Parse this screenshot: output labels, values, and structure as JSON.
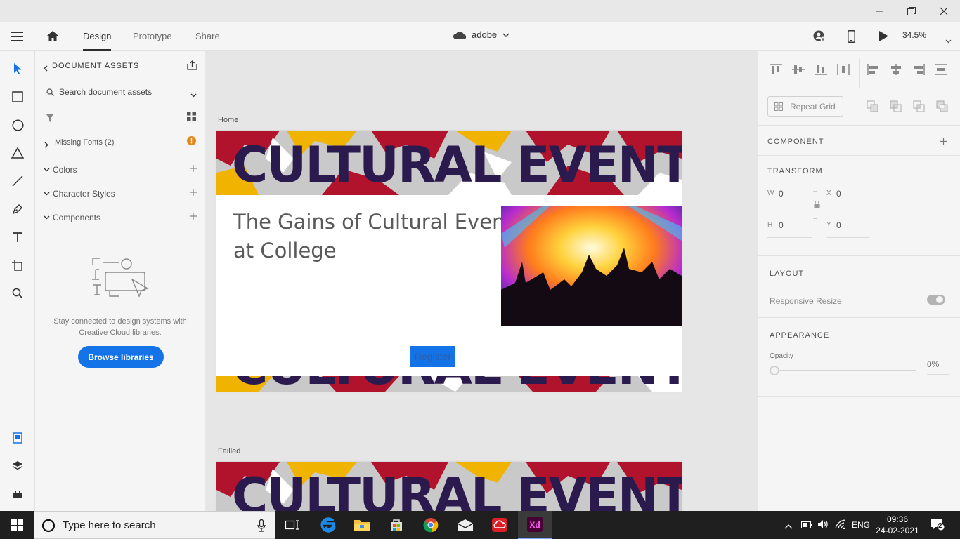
{
  "window": {
    "minimize_icon": "minimize-icon",
    "maximize_icon": "restore-icon",
    "close_icon": "close-icon"
  },
  "appbar": {
    "tabs": [
      {
        "label": "Design"
      },
      {
        "label": "Prototype"
      },
      {
        "label": "Share"
      }
    ],
    "doc_name": "adobe",
    "zoom": "34.5%"
  },
  "assets": {
    "title": "DOCUMENT ASSETS",
    "search_placeholder": "Search document assets",
    "missing_fonts": "Missing Fonts (2)",
    "sections": [
      {
        "label": "Colors"
      },
      {
        "label": "Character Styles"
      },
      {
        "label": "Components"
      }
    ],
    "empty_text_1": "Stay connected to design systems with",
    "empty_text_2": "Creative Cloud libraries.",
    "browse_button": "Browse libraries"
  },
  "canvas": {
    "artboard1_label": "Home",
    "artboard2_label": "Failled",
    "banner_text": "CULTURAL EVENT",
    "heading_line1": "The Gains of Cultural Events",
    "heading_line2": "at College",
    "register_button": "Register"
  },
  "props": {
    "repeat_grid": "Repeat Grid",
    "component": "COMPONENT",
    "transform": "TRANSFORM",
    "w_label": "W",
    "w_value": "0",
    "x_label": "X",
    "x_value": "0",
    "h_label": "H",
    "h_value": "0",
    "y_label": "Y",
    "y_value": "0",
    "layout": "LAYOUT",
    "responsive_resize": "Responsive Resize",
    "appearance": "APPEARANCE",
    "opacity_label": "Opacity",
    "opacity_value": "0%"
  },
  "taskbar": {
    "search_placeholder": "Type here to search",
    "language": "ENG",
    "time": "09:36",
    "date": "24-02-2021",
    "notifications": "2"
  },
  "colors": {
    "accent": "#1473e6",
    "xd": "#470137",
    "xd_text": "#ff61f6",
    "banner_text": "#2b1a4d"
  }
}
